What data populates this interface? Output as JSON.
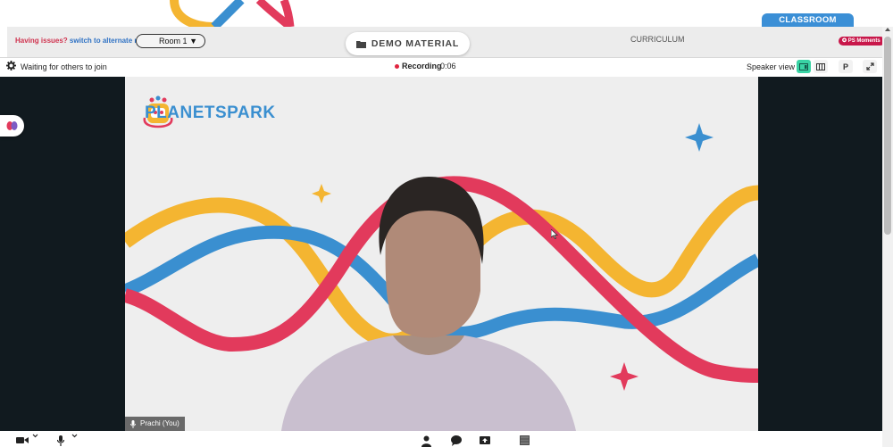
{
  "classroom_tab": {
    "label": "CLASSROOM"
  },
  "toolbar_top": {
    "issue_prefix": "Having issues?",
    "issue_link": "switch to alternate room",
    "room_select": {
      "value": "Room 1"
    },
    "demo_material": "DEMO MATERIAL",
    "curriculum": "CURRICULUM",
    "ps_moments": "PS Moments"
  },
  "meeting": {
    "status": "Waiting for others to join",
    "recording_label": "Recording",
    "recording_time": "0:06",
    "view_label": "Speaker view",
    "p_button": "P"
  },
  "video": {
    "brand": "PLANETSPARK",
    "participant_name": "Prachi (You)"
  },
  "colors": {
    "accent_green": "#39d3a4",
    "classroom_blue": "#3b8fd6",
    "record_red": "#e0243f",
    "wave_red": "#e23a5c",
    "wave_yellow": "#f4b531",
    "wave_blue": "#3a8fd0"
  },
  "icons": [
    "gear-icon",
    "speaker-view-icon",
    "grid-view-icon",
    "expand-icon",
    "folder-icon",
    "brain-icon",
    "mic-icon",
    "camera-icon",
    "chevron-down-icon",
    "participant-icon",
    "chat-icon",
    "share-icon",
    "more-icon",
    "cursor-icon"
  ]
}
